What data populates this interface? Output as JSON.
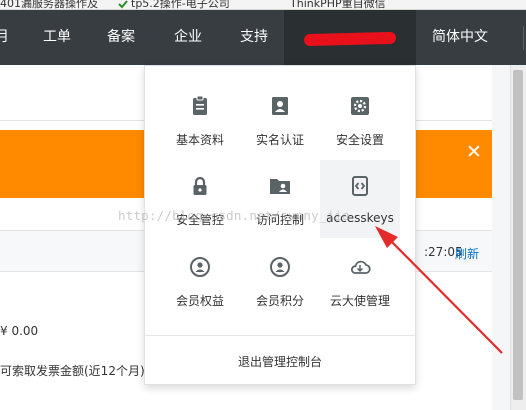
{
  "bookmarks": [
    {
      "label": "401漏服务器操作及"
    },
    {
      "label": "tp5.2操作-电子公司"
    },
    {
      "label": "ThinkPHP重自微信"
    }
  ],
  "nav": {
    "items": [
      "月",
      "工单",
      "备案",
      "企业",
      "支持"
    ],
    "language": "简体中文"
  },
  "dropdown": {
    "items": [
      {
        "label": "基本资料",
        "icon": "clipboard-icon"
      },
      {
        "label": "实名认证",
        "icon": "id-card-icon"
      },
      {
        "label": "安全设置",
        "icon": "gear-icon"
      },
      {
        "label": "安全管控",
        "icon": "lock-icon"
      },
      {
        "label": "访问控制",
        "icon": "user-folder-icon"
      },
      {
        "label": "accesskeys",
        "icon": "key-code-icon"
      },
      {
        "label": "会员权益",
        "icon": "member-icon"
      },
      {
        "label": "会员积分",
        "icon": "points-icon"
      },
      {
        "label": "云大使管理",
        "icon": "cloud-icon"
      }
    ],
    "logout": "退出管理控制台"
  },
  "background": {
    "time": ":27:05",
    "refresh": "刷新",
    "amount": "¥ 0.00",
    "invoice": "可索取发票金额(近12个月)"
  },
  "watermark": "http://blog.csdn.net/sunny_jie",
  "colors": {
    "nav_bg": "#373d41",
    "banner": "#ff8a00",
    "redaction": "#e8111b",
    "link": "#0070cc",
    "icon": "#5a6366"
  }
}
